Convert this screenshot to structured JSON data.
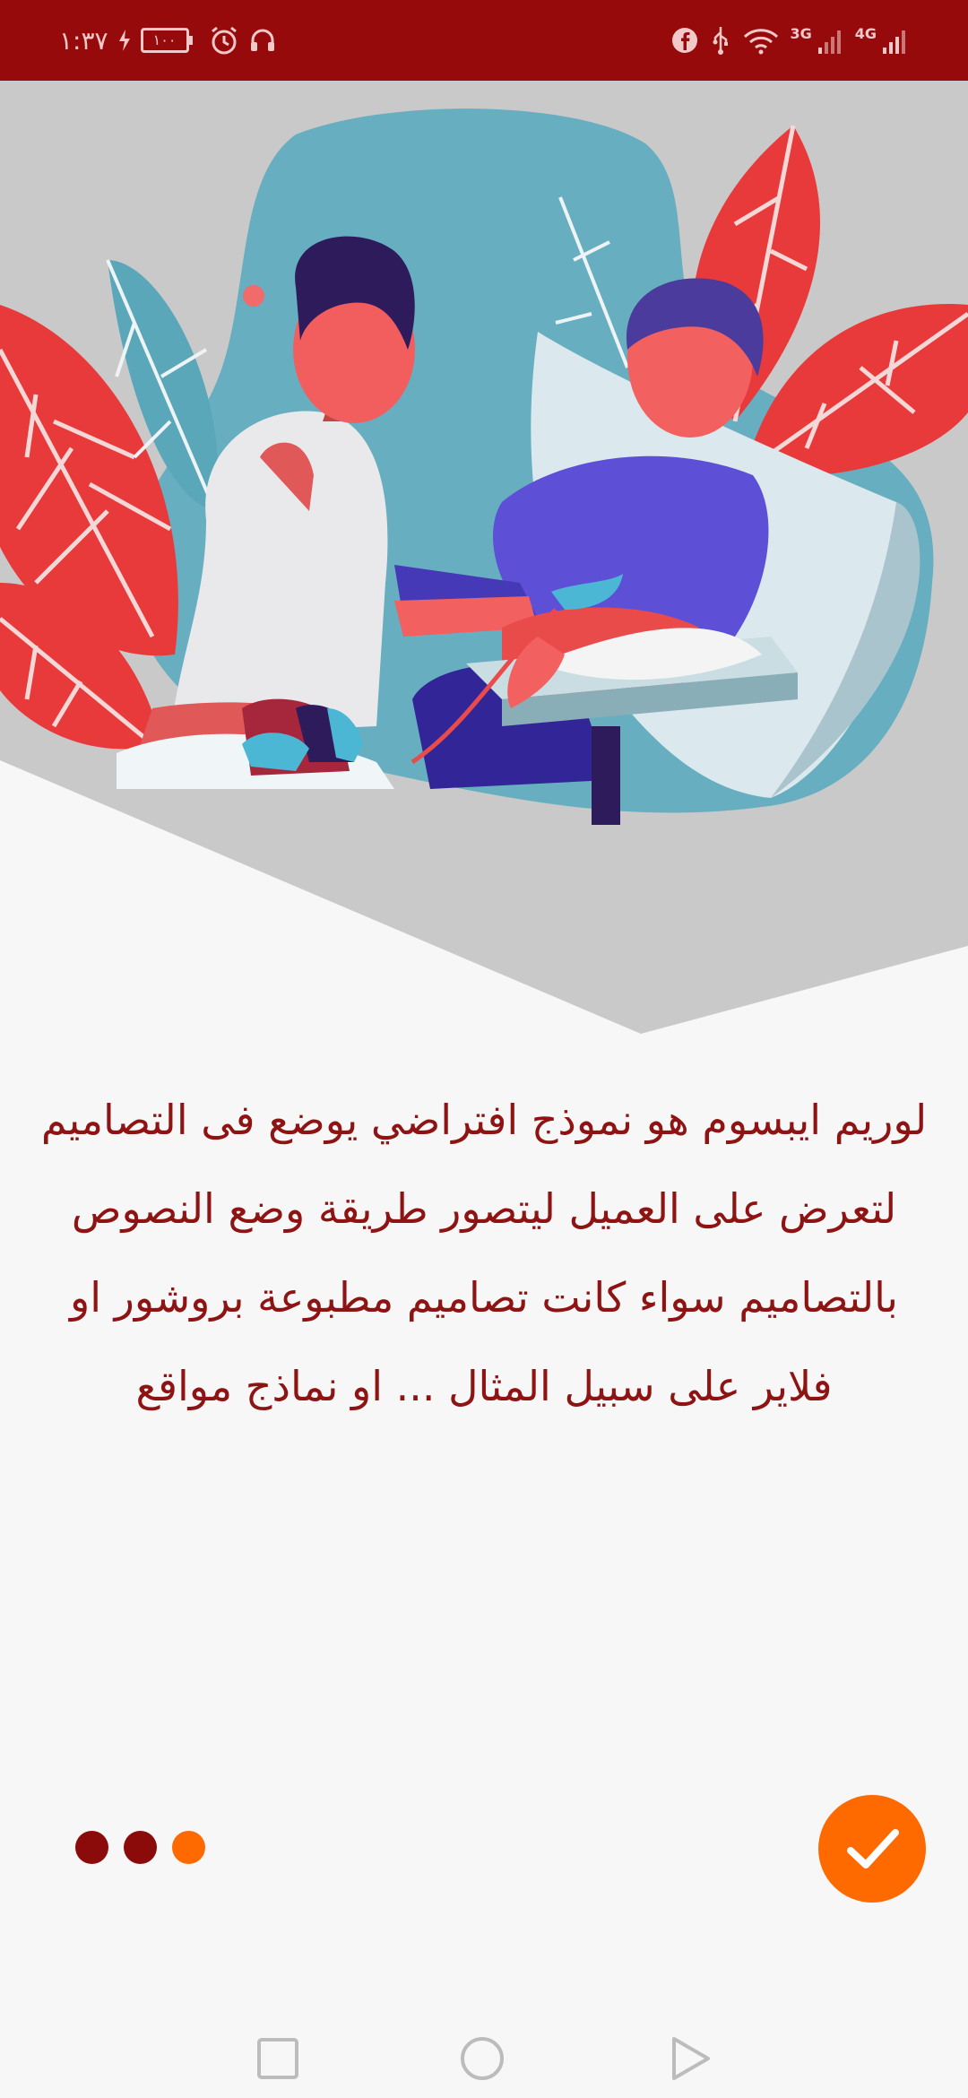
{
  "status_bar": {
    "time": "١:٣٧",
    "battery": "١٠٠",
    "network_3g": "3G",
    "network_4g": "4G",
    "left_icons": [
      "charging-bolt-icon",
      "battery-icon",
      "alarm-icon",
      "headphones-icon"
    ],
    "right_icons": [
      "facebook-icon",
      "usb-icon",
      "wifi-icon",
      "signal-3g-icon",
      "signal-4g-icon"
    ]
  },
  "hero": {
    "illustration": "blood-donation-illustration"
  },
  "onboarding": {
    "body_text": "لوريم ايبسوم هو نموذج افتراضي يوضع فى التصاميم لتعرض على العميل ليتصور طريقة وضع النصوص بالتصاميم سواء كانت تصاميم مطبوعة بروشور او فلاير على سبيل المثال ... او نماذج مواقع",
    "page_count": 3,
    "current_page": 3,
    "done_icon": "checkmark-icon"
  },
  "colors": {
    "status_bar": "#970a0b",
    "accent": "#ff6a00",
    "dot_inactive": "#8b0a0a",
    "text": "#8e1414",
    "hero_background": "#c9c9c9"
  },
  "nav_bar": {
    "items": [
      "recents-square-icon",
      "home-circle-icon",
      "back-triangle-icon"
    ]
  }
}
